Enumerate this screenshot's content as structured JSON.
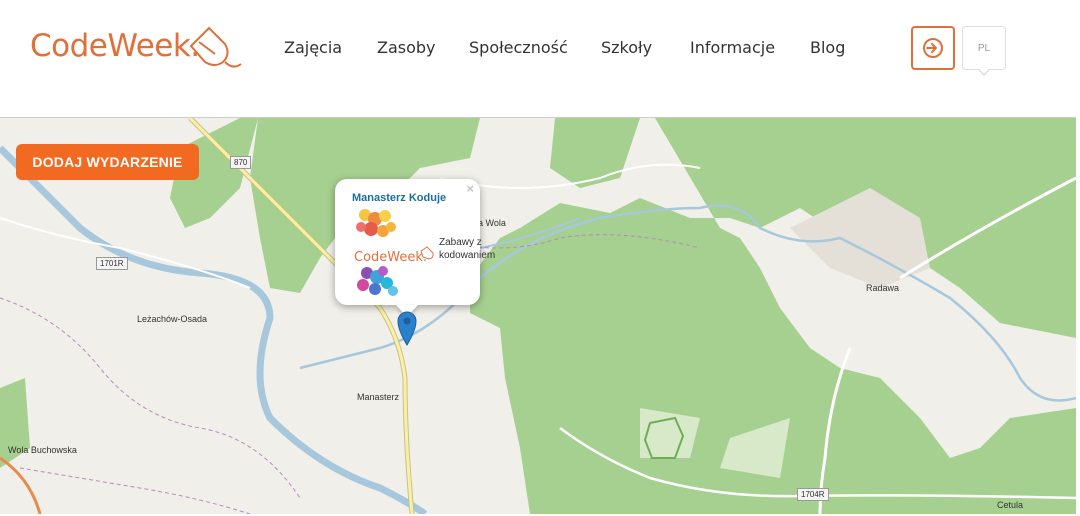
{
  "header": {
    "logo_text": "CodeWeek.",
    "nav": [
      {
        "label": "Zajęcia"
      },
      {
        "label": "Zasoby"
      },
      {
        "label": "Społeczność"
      },
      {
        "label": "Szkoły"
      },
      {
        "label": "Informacje"
      },
      {
        "label": "Blog"
      }
    ],
    "login_icon": "sign-in-icon",
    "lang_label": "PL"
  },
  "map": {
    "add_event_label": "DODAJ WYDARZENIE",
    "places": {
      "lezachow": "Leżachów-Osada",
      "manasterz": "Manasterz",
      "wola_buchowska": "Wola Buchowska",
      "wola": "a Wola",
      "radawa": "Radawa",
      "cetula": "Cetula"
    },
    "roads": {
      "r870": "870",
      "r1701": "1701R",
      "r1704": "1704R"
    },
    "popup": {
      "title": "Manasterz Koduje",
      "close": "×",
      "image_logo_text": "CodeWeek.",
      "description": "Zabawy z kodowaniem"
    },
    "marker_icon": "map-pin-icon"
  },
  "colors": {
    "brand": "#e0703a",
    "button": "#f26a22",
    "forest": "#a6d08f",
    "river": "#a7c8dc",
    "marker": "#2a81cb"
  }
}
